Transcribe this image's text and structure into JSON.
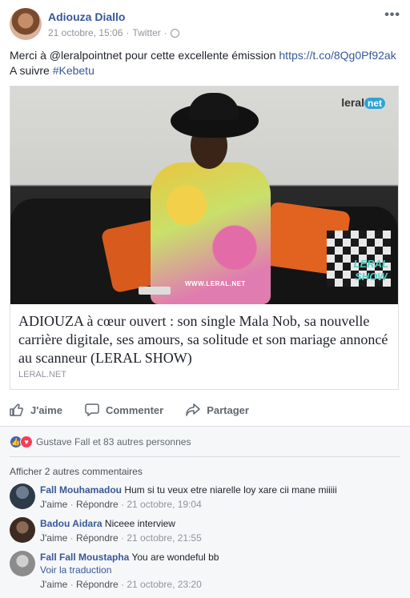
{
  "post": {
    "author": "Adiouza Diallo",
    "date": "21 octobre, 15:06",
    "source": "Twitter",
    "separator": "·",
    "line1_prefix": "Merci à @leralpointnet pour cette excellente émission ",
    "line1_link": "https://t.co/8Qg0Pf92ak",
    "line2_prefix": "A suivre ",
    "line2_hashtag": "#Kebetu"
  },
  "link_card": {
    "title": "ADIOUZA à cœur ouvert : son single Mala Nob, sa nouvelle carrière digitale, ses amours, sa solitude et son mariage annoncé au scanneur (LERAL SHOW)",
    "source": "LERAL.NET",
    "logo_word": "leral",
    "logo_net": "net",
    "show_line1": "LERAL",
    "show_line2": "SHOW",
    "watermark": "WWW.LERAL.NET"
  },
  "actions": {
    "like": "J'aime",
    "comment": "Commenter",
    "share": "Partager"
  },
  "reactions": {
    "text": "Gustave Fall et 83 autres personnes"
  },
  "comments_section": {
    "more_comments": "Afficher 2 autres commentaires",
    "like_label": "J'aime",
    "reply_label": "Répondre",
    "comments": [
      {
        "name": "Fall Mouhamadou",
        "text": "Hum si tu veux etre niarelle loy xare cii mane miiiii",
        "time": "21 octobre, 19:04"
      },
      {
        "name": "Badou Aidara",
        "text": "Niceee interview",
        "time": "21 octobre, 21:55"
      },
      {
        "name": "Fall Fall Moustapha",
        "text": "You are wondeful bb",
        "translate": "Voir la traduction",
        "time": "21 octobre, 23:20"
      }
    ]
  },
  "colors": {
    "link": "#365899",
    "like_blue": "#4267b2",
    "love_red": "#f33e58"
  },
  "icons": [
    "globe-icon",
    "more-options-icon",
    "like-icon",
    "comment-icon",
    "share-icon"
  ]
}
